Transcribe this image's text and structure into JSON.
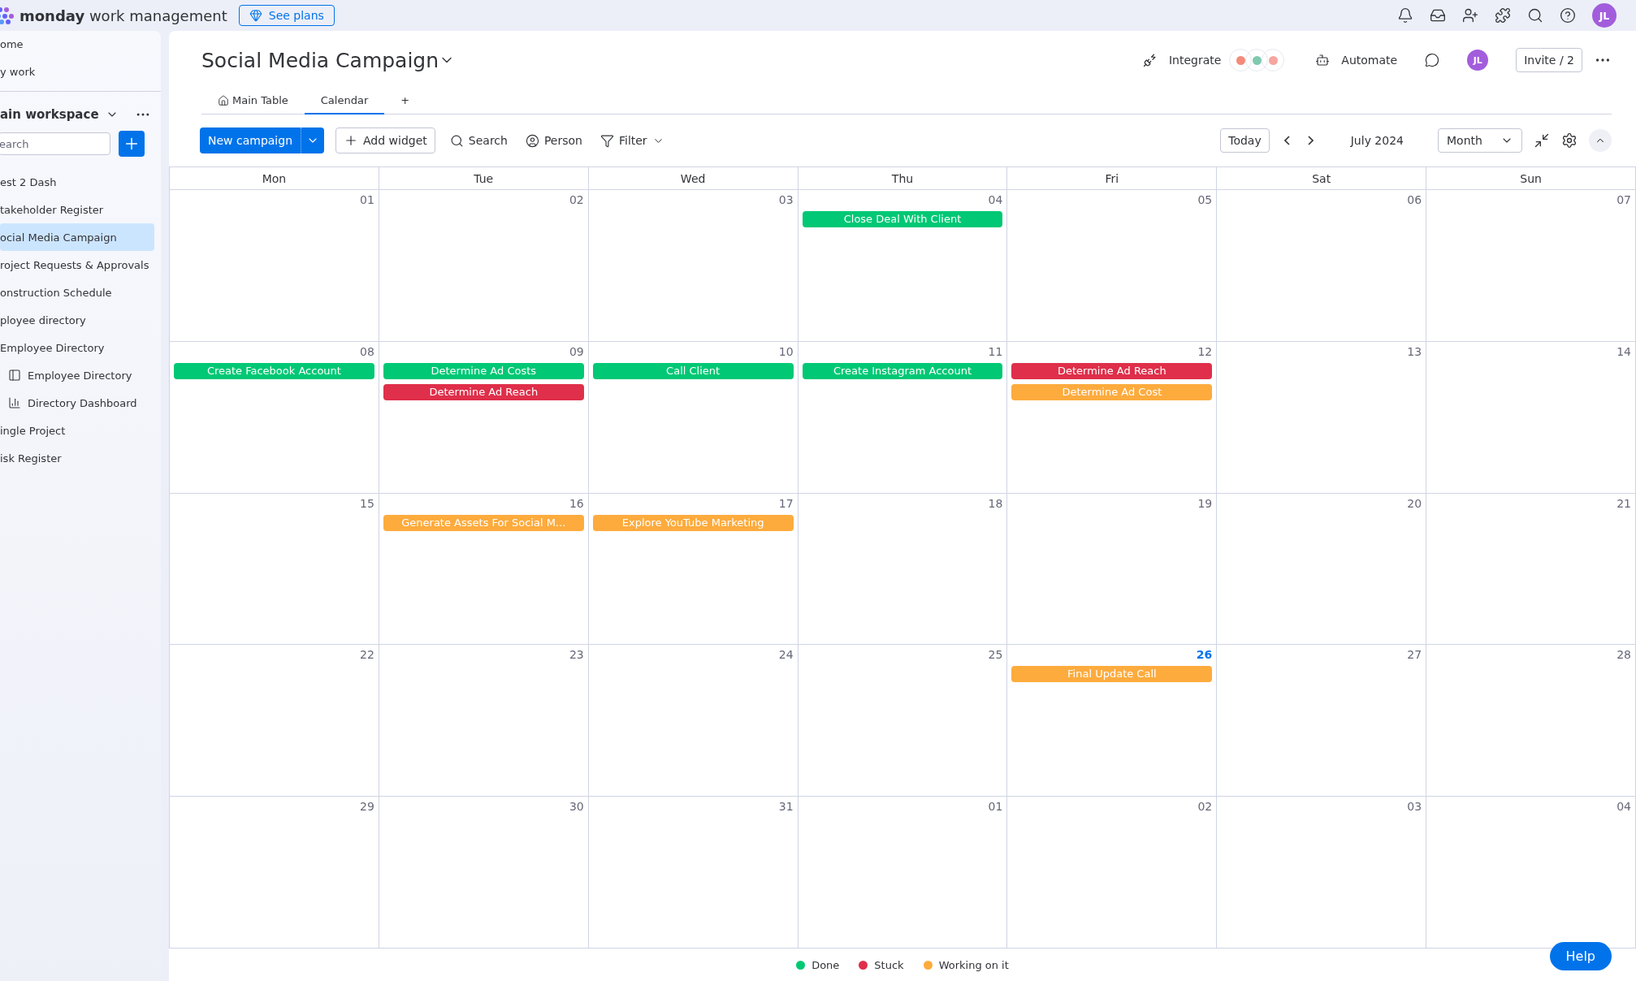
{
  "topbar": {
    "brand_bold": "monday",
    "brand_rest": "work management",
    "plans_button": "See plans",
    "avatar": "JL"
  },
  "sidebar": {
    "nav": [
      {
        "label": "ome"
      },
      {
        "label": "y work"
      }
    ],
    "workspace": "ain workspace",
    "search": {
      "placeholder": "earch"
    },
    "items": [
      {
        "label": "est 2 Dash",
        "selected": false
      },
      {
        "label": "takeholder Register",
        "selected": false
      },
      {
        "label": "ocial Media Campaign",
        "selected": true
      },
      {
        "label": "roject Requests & Approvals",
        "selected": false
      },
      {
        "label": "onstruction Schedule",
        "selected": false
      },
      {
        "label": "ployee directory",
        "selected": false
      },
      {
        "label": "Employee Directory",
        "selected": false,
        "children": [
          {
            "label": "Employee Directory",
            "kind": "board",
            "selected": false
          },
          {
            "label": "Directory Dashboard",
            "kind": "dashboard",
            "selected": false
          }
        ]
      },
      {
        "label": "ingle Project",
        "selected": false
      },
      {
        "label": "isk Register",
        "selected": false
      }
    ]
  },
  "board": {
    "title": "Social Media Campaign",
    "integrate": "Integrate",
    "automate": "Automate",
    "avatar": "JL",
    "invite": "Invite / 2",
    "tabs": [
      {
        "label": "Main Table",
        "selected": false
      },
      {
        "label": "Calendar",
        "selected": true
      }
    ],
    "add_tab": "+"
  },
  "toolbar": {
    "new_button": "New campaign",
    "add_widget": "Add widget",
    "search": "Search",
    "person": "Person",
    "filter": "Filter",
    "today": "Today",
    "month_label": "July 2024",
    "view_select": "Month"
  },
  "calendar": {
    "weekdays": [
      "Mon",
      "Tue",
      "Wed",
      "Thu",
      "Fri",
      "Sat",
      "Sun"
    ],
    "weeks": [
      [
        {
          "date": "01",
          "today": false
        },
        {
          "date": "02",
          "today": false
        },
        {
          "date": "03",
          "today": false
        },
        {
          "date": "04",
          "today": false,
          "events": [
            {
              "title": "Close Deal With Client",
              "color": "#00c875"
            }
          ]
        },
        {
          "date": "05",
          "today": false
        },
        {
          "date": "06",
          "today": false
        },
        {
          "date": "07",
          "today": false
        }
      ],
      [
        {
          "date": "08",
          "today": false,
          "events": [
            {
              "title": "Create Facebook Account",
              "color": "#00c875"
            }
          ]
        },
        {
          "date": "09",
          "today": false,
          "events": [
            {
              "title": "Determine Ad Costs",
              "color": "#00c875"
            },
            {
              "title": "Determine Ad Reach",
              "color": "#df2f4a"
            }
          ]
        },
        {
          "date": "10",
          "today": false,
          "events": [
            {
              "title": "Call Client",
              "color": "#00c875"
            }
          ]
        },
        {
          "date": "11",
          "today": false,
          "events": [
            {
              "title": "Create Instagram Account",
              "color": "#00c875"
            }
          ]
        },
        {
          "date": "12",
          "today": false,
          "events": [
            {
              "title": "Determine Ad Reach",
              "color": "#df2f4a"
            },
            {
              "title": "Determine Ad Cost",
              "color": "#fdab3d"
            }
          ]
        },
        {
          "date": "13",
          "today": false
        },
        {
          "date": "14",
          "today": false
        }
      ],
      [
        {
          "date": "15",
          "today": false
        },
        {
          "date": "16",
          "today": false,
          "events": [
            {
              "title": "Generate Assets For Social M...",
              "color": "#fdab3d"
            }
          ]
        },
        {
          "date": "17",
          "today": false,
          "events": [
            {
              "title": "Explore YouTube Marketing",
              "color": "#fdab3d"
            }
          ]
        },
        {
          "date": "18",
          "today": false
        },
        {
          "date": "19",
          "today": false
        },
        {
          "date": "20",
          "today": false
        },
        {
          "date": "21",
          "today": false
        }
      ],
      [
        {
          "date": "22",
          "today": false
        },
        {
          "date": "23",
          "today": false
        },
        {
          "date": "24",
          "today": false
        },
        {
          "date": "25",
          "today": false
        },
        {
          "date": "26",
          "today": true,
          "events": [
            {
              "title": "Final Update Call",
              "color": "#fdab3d"
            }
          ]
        },
        {
          "date": "27",
          "today": false
        },
        {
          "date": "28",
          "today": false
        }
      ],
      [
        {
          "date": "29",
          "today": false
        },
        {
          "date": "30",
          "today": false
        },
        {
          "date": "31",
          "today": false
        },
        {
          "date": "01",
          "today": false
        },
        {
          "date": "02",
          "today": false
        },
        {
          "date": "03",
          "today": false
        },
        {
          "date": "04",
          "today": false
        }
      ]
    ]
  },
  "legend": [
    {
      "label": "Done",
      "color": "#00c875"
    },
    {
      "label": "Stuck",
      "color": "#df2f4a"
    },
    {
      "label": "Working on it",
      "color": "#fdab3d"
    }
  ],
  "help_button": "Help"
}
